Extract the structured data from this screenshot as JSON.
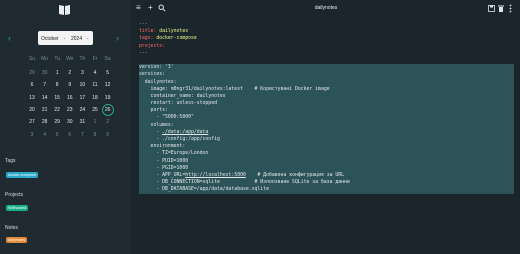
{
  "app": {
    "window_title": "dailynotes"
  },
  "sidebar": {
    "calendar": {
      "month": "October",
      "year": "2024",
      "prev_arrow": "‹",
      "next_arrow": "›",
      "caret": "⌄",
      "weekdays": [
        "Su",
        "Mo",
        "Tu",
        "We",
        "Th",
        "Fr",
        "Sa"
      ],
      "weeks": [
        [
          "29",
          "30",
          "1",
          "2",
          "3",
          "4",
          "5"
        ],
        [
          "6",
          "7",
          "8",
          "9",
          "10",
          "11",
          "12"
        ],
        [
          "13",
          "14",
          "15",
          "16",
          "17",
          "18",
          "19"
        ],
        [
          "20",
          "21",
          "22",
          "23",
          "24",
          "25",
          "26"
        ],
        [
          "27",
          "28",
          "29",
          "30",
          "31",
          "1",
          "2"
        ],
        [
          "3",
          "4",
          "5",
          "6",
          "7",
          "8",
          "9"
        ]
      ],
      "selected": "26"
    },
    "tags": {
      "title": "Tags",
      "items": [
        "docker-compose"
      ]
    },
    "projects": {
      "title": "Projects",
      "items": [
        "Selfhosted"
      ]
    },
    "notes": {
      "title": "Notes",
      "items": [
        "dailynotes"
      ]
    }
  },
  "toolbar": {
    "menu_icon": "≡",
    "add_icon": "+",
    "search_icon": "🔍",
    "icons_right": [
      "save-icon",
      "trash-icon",
      "more-icon"
    ]
  },
  "editor": {
    "lines": [
      {
        "text": "---",
        "hl": false,
        "kind": "dim"
      },
      {
        "key": "title:",
        "val": " dailynotes",
        "hl": false,
        "kind": "fm"
      },
      {
        "key": "tags:",
        "val": " docker-compose",
        "hl": false,
        "kind": "fm"
      },
      {
        "key": "projects:",
        "val": "",
        "hl": false,
        "kind": "fm"
      },
      {
        "text": "---",
        "hl": false,
        "kind": "dim"
      },
      {
        "text": "",
        "hl": false,
        "kind": "plain"
      },
      {
        "text": "version: '3'",
        "hl": true,
        "kind": "plain"
      },
      {
        "text": "services:",
        "hl": true,
        "kind": "plain"
      },
      {
        "text": "  dailynotes:",
        "hl": true,
        "kind": "plain"
      },
      {
        "text": "    image: m0ngr31/dailynotes:latest    # Користувані Docker image",
        "hl": true,
        "kind": "plain"
      },
      {
        "text": "    container_name: dailynotes",
        "hl": true,
        "kind": "plain"
      },
      {
        "text": "    restart: unless-stopped",
        "hl": true,
        "kind": "plain"
      },
      {
        "text": "    ports:",
        "hl": true,
        "kind": "plain"
      },
      {
        "text": "      - \"5000:5000\"",
        "hl": true,
        "kind": "plain"
      },
      {
        "text": "    volumes:",
        "hl": true,
        "kind": "plain"
      },
      {
        "pre": "      - ",
        "url": "./data:/app/data",
        "post": "",
        "hl": true,
        "kind": "url"
      },
      {
        "text": "      - ./config:/app/config",
        "hl": true,
        "kind": "plain"
      },
      {
        "text": "    environment:",
        "hl": true,
        "kind": "plain"
      },
      {
        "text": "      - TZ=Europe/London",
        "hl": true,
        "kind": "plain"
      },
      {
        "text": "      - PUID=1000",
        "hl": true,
        "kind": "plain"
      },
      {
        "text": "      - PGID=1000",
        "hl": true,
        "kind": "plain"
      },
      {
        "pre": "      - APP_URL=",
        "url": "http://localhost:5000",
        "post": "    # Добавена конфигурация за URL",
        "hl": true,
        "kind": "url"
      },
      {
        "text": "      - DB_CONNECTION=sqlite            # Използване SQLite за база данни",
        "hl": true,
        "kind": "plain"
      },
      {
        "text": "      - DB_DATABASE=/app/data/database.sqlite",
        "hl": true,
        "kind": "plain"
      }
    ]
  },
  "colors": {
    "accent": "#25a58b",
    "tag_pill": "#2aa7c9",
    "project_pill": "#1bb08d",
    "note_pill": "#e08a3a",
    "highlight": "#2b5358"
  }
}
